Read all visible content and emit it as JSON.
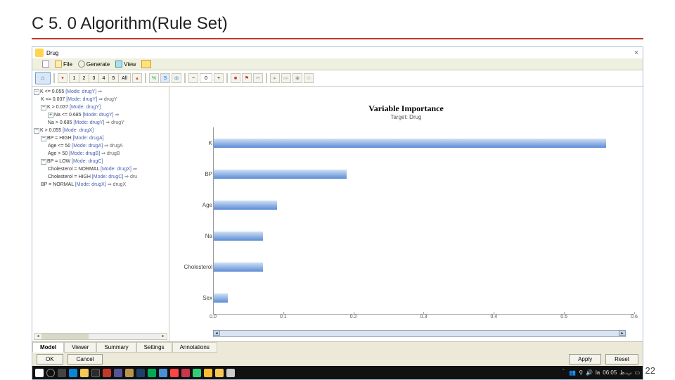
{
  "slide": {
    "title": "C 5. 0 Algorithm(Rule Set)",
    "page_num": "22"
  },
  "window": {
    "title": "Drug",
    "close": "×"
  },
  "menu": {
    "file": "File",
    "generate": "Generate",
    "view": "View"
  },
  "toolbar": {
    "nums": [
      "1",
      "2",
      "3",
      "4",
      "5"
    ],
    "all": "All",
    "zoom_val": "0"
  },
  "tree": [
    {
      "cls": "",
      "pm": "−",
      "text": "K <= 0.055 ",
      "mode": "[Mode: drugY]",
      "tail": " ⇒"
    },
    {
      "cls": "ind1",
      "pm": "",
      "text": "K <= 0.037 ",
      "mode": "[Mode: drugY]",
      "tail": " ⇒ drugY"
    },
    {
      "cls": "ind1",
      "pm": "−",
      "text": "K > 0.037 ",
      "mode": "[Mode: drugY]",
      "tail": ""
    },
    {
      "cls": "ind2",
      "pm": "+",
      "text": "Na <= 0.685 ",
      "mode": "[Mode: drugY]",
      "tail": " ⇒"
    },
    {
      "cls": "ind2",
      "pm": "",
      "text": "Na > 0.685 ",
      "mode": "[Mode: drugY]",
      "tail": " ⇒ drugY"
    },
    {
      "cls": "",
      "pm": "−",
      "text": "K > 0.055 ",
      "mode": "[Mode: drugX]",
      "tail": ""
    },
    {
      "cls": "ind1",
      "pm": "−",
      "text": "BP = HIGH ",
      "mode": "[Mode: drugA]",
      "tail": ""
    },
    {
      "cls": "ind2",
      "pm": "",
      "text": "Age <= 50 ",
      "mode": "[Mode: drugA]",
      "tail": " ⇒ drugA"
    },
    {
      "cls": "ind2",
      "pm": "",
      "text": "Age > 50 ",
      "mode": "[Mode: drugB]",
      "tail": " ⇒ drugB"
    },
    {
      "cls": "ind1",
      "pm": "−",
      "text": "BP = LOW ",
      "mode": "[Mode: drugC]",
      "tail": ""
    },
    {
      "cls": "ind2",
      "pm": "",
      "text": "Cholesterol = NORMAL ",
      "mode": "[Mode: drugX]",
      "tail": " ⇒"
    },
    {
      "cls": "ind2",
      "pm": "",
      "text": "Cholesterol = HIGH ",
      "mode": "[Mode: drugC]",
      "tail": " ⇒ dru"
    },
    {
      "cls": "ind1",
      "pm": "",
      "text": "BP = NORMAL ",
      "mode": "[Mode: drugX]",
      "tail": " ⇒ drugX"
    }
  ],
  "chart_data": {
    "type": "bar",
    "orientation": "horizontal",
    "title": "Variable Importance",
    "subtitle": "Target: Drug",
    "categories": [
      "K",
      "BP",
      "Age",
      "Na",
      "Cholesterol",
      "Sex"
    ],
    "values": [
      0.56,
      0.19,
      0.09,
      0.07,
      0.07,
      0.02
    ],
    "xlim": [
      0.0,
      0.6
    ],
    "xticks": [
      "0.0",
      "0.1",
      "0.2",
      "0.3",
      "0.4",
      "0.5",
      "0.6"
    ]
  },
  "tabs": {
    "model": "Model",
    "viewer": "Viewer",
    "summary": "Summary",
    "settings": "Settings",
    "annotations": "Annotations"
  },
  "buttons": {
    "ok": "OK",
    "cancel": "Cancel",
    "apply": "Apply",
    "reset": "Reset"
  },
  "taskbar": {
    "time": "06:05",
    "lang": "la",
    "suffix": "ب.ظ"
  }
}
